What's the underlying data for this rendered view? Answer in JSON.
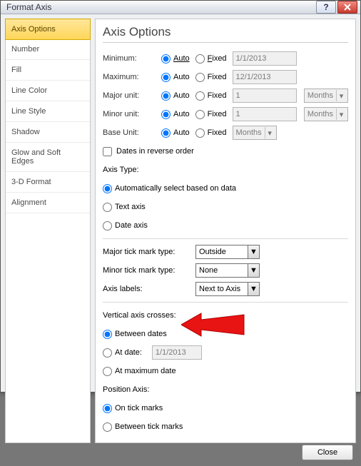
{
  "window": {
    "title": "Format Axis"
  },
  "nav": {
    "items": [
      {
        "label": "Axis Options"
      },
      {
        "label": "Number"
      },
      {
        "label": "Fill"
      },
      {
        "label": "Line Color"
      },
      {
        "label": "Line Style"
      },
      {
        "label": "Shadow"
      },
      {
        "label": "Glow and Soft Edges"
      },
      {
        "label": "3-D Format"
      },
      {
        "label": "Alignment"
      }
    ],
    "selected_index": 0
  },
  "panel": {
    "heading": "Axis Options",
    "bounds": {
      "minimum": {
        "label": "Minimum:",
        "auto": "Auto",
        "fixed": "Fixed",
        "value": "1/1/2013",
        "selected": "auto"
      },
      "maximum": {
        "label": "Maximum:",
        "auto": "Auto",
        "fixed": "Fixed",
        "value": "12/1/2013",
        "selected": "auto"
      },
      "major": {
        "label": "Major unit:",
        "auto": "Auto",
        "fixed": "Fixed",
        "value": "1",
        "unit": "Months",
        "selected": "auto"
      },
      "minor": {
        "label": "Minor unit:",
        "auto": "Auto",
        "fixed": "Fixed",
        "value": "1",
        "unit": "Months",
        "selected": "auto"
      },
      "base": {
        "label": "Base Unit:",
        "auto": "Auto",
        "fixed": "Fixed",
        "unit": "Months",
        "selected": "auto"
      }
    },
    "reverse": {
      "label": "Dates in reverse order",
      "checked": false
    },
    "axis_type": {
      "label": "Axis Type:",
      "auto": "Automatically select based on data",
      "text": "Text axis",
      "date": "Date axis",
      "selected": "auto"
    },
    "ticks": {
      "major": {
        "label": "Major tick mark type:",
        "value": "Outside"
      },
      "minor": {
        "label": "Minor tick mark type:",
        "value": "None"
      },
      "labels": {
        "label": "Axis labels:",
        "value": "Next to Axis"
      }
    },
    "crosses": {
      "label": "Vertical axis crosses:",
      "between": "Between dates",
      "atdate_label": "At date:",
      "atdate_value": "1/1/2013",
      "atmax": "At maximum date",
      "selected": "between"
    },
    "position": {
      "label": "Position Axis:",
      "on": "On tick marks",
      "between": "Between tick marks",
      "selected": "on"
    }
  },
  "footer": {
    "close": "Close"
  }
}
